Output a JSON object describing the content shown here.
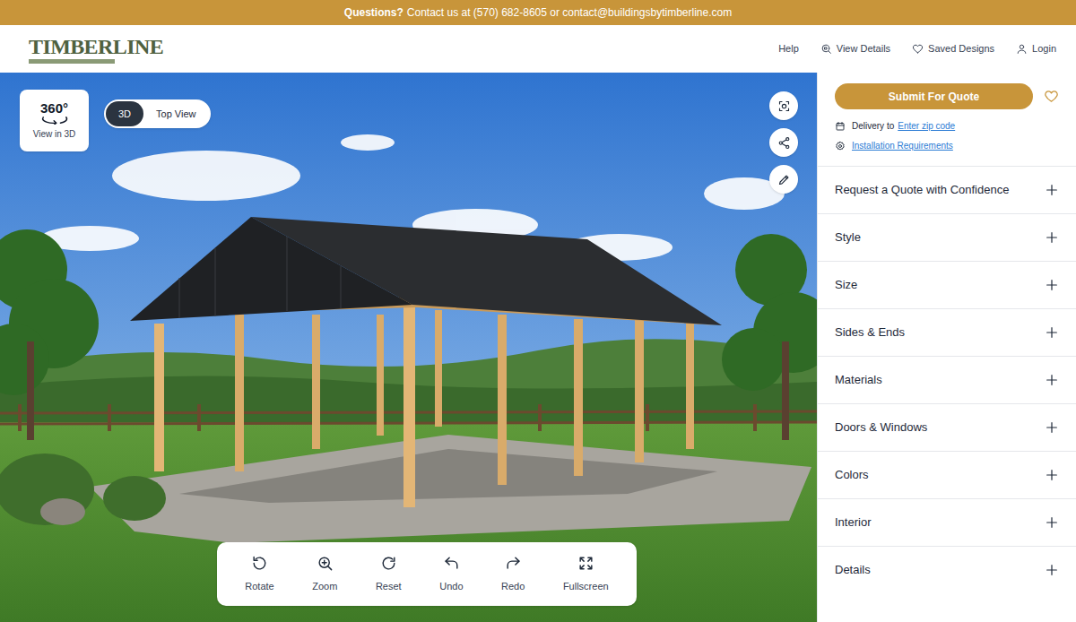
{
  "banner": {
    "lead": "Questions?",
    "text": "Contact us at (570) 682-8605 or contact@buildingsbytimberline.com"
  },
  "logo": {
    "text": "TIMBERLINE"
  },
  "nav": [
    {
      "label": "Help"
    },
    {
      "label": "View Details"
    },
    {
      "label": "Saved Designs"
    },
    {
      "label": "Login"
    }
  ],
  "viewer": {
    "view_360": {
      "badge": "360°",
      "label": "View in 3D"
    },
    "view_toggle": [
      {
        "label": "3D",
        "selected": true
      },
      {
        "label": "Top View",
        "selected": false
      }
    ],
    "toolbar": [
      {
        "label": "Rotate"
      },
      {
        "label": "Zoom"
      },
      {
        "label": "Reset"
      },
      {
        "label": "Undo"
      },
      {
        "label": "Redo"
      },
      {
        "label": "Fullscreen"
      }
    ]
  },
  "sidebar": {
    "submit": "Submit For Quote",
    "favorited": false,
    "delivery": {
      "label": "Delivery to",
      "link": "Enter zip code"
    },
    "installation": "Installation Requirements",
    "sections": [
      {
        "label": "Request a Quote with Confidence",
        "expanded": false
      },
      {
        "label": "Style",
        "expanded": false
      },
      {
        "label": "Size",
        "expanded": false
      },
      {
        "label": "Sides & Ends",
        "expanded": false
      },
      {
        "label": "Materials",
        "expanded": false
      },
      {
        "label": "Doors & Windows",
        "expanded": false
      },
      {
        "label": "Colors",
        "expanded": false
      },
      {
        "label": "Interior",
        "expanded": false
      },
      {
        "label": "Details",
        "expanded": false
      }
    ]
  }
}
